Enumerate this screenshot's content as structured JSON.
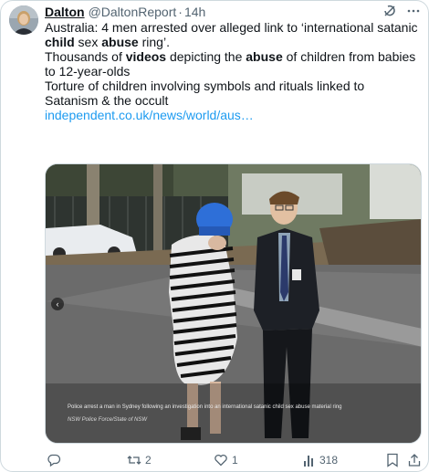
{
  "author": {
    "display_name": "Dalton",
    "handle": "@DaltonReport",
    "separator": "·",
    "time": "14h"
  },
  "header_icons": [
    "grok-icon",
    "more-icon"
  ],
  "tweet": {
    "line1_a": "Australia: 4 men arrested over alleged link to ‘international satanic ",
    "line1_b": "child",
    "line1_c": " sex ",
    "line1_d": "abuse",
    "line1_e": " ring’.",
    "line2_a": "Thousands of ",
    "line2_b": "videos",
    "line2_c": " depicting the ",
    "line2_d": "abuse",
    "line2_e": " of children from babies to 12-year-olds",
    "line3": "Torture of children involving symbols and rituals linked to Satanism & the occult",
    "link": "independent.co.uk/news/world/aus…"
  },
  "media": {
    "caption": "Police arrest a man in Sydney following an investigation into an international satanic child sex abuse material ring",
    "credit": "NSW Police Force/State of NSW",
    "prev_icon": "chevron-left-icon"
  },
  "actions": {
    "reply_count": "",
    "retweet_count": "2",
    "like_count": "1",
    "views_count": "318"
  },
  "colors": {
    "text": "#0f1419",
    "secondary": "#536471",
    "link": "#1d9bf0",
    "border": "#cfd9de"
  }
}
